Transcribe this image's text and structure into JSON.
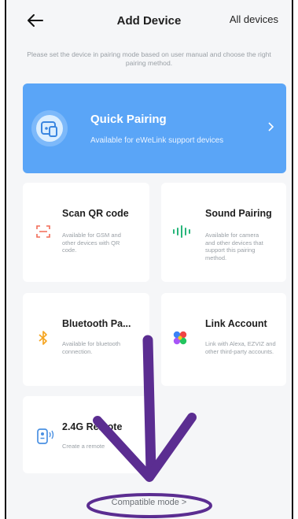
{
  "header": {
    "title": "Add Device",
    "all_devices": "All devices"
  },
  "hint": "Please set the device in pairing mode based on user manual and choose the right pairing method.",
  "quick_pairing": {
    "title": "Quick Pairing",
    "subtitle": "Available for eWeLink support devices"
  },
  "options": {
    "scan_qr": {
      "title": "Scan QR code",
      "desc": "Available for GSM and other devices with QR code."
    },
    "sound": {
      "title": "Sound Pairing",
      "desc": "Available for camera and other devices that support this pairing method."
    },
    "bluetooth": {
      "title": "Bluetooth Pa...",
      "desc": "Available for bluetooth connection."
    },
    "link": {
      "title": "Link Account",
      "desc": "Link with Alexa, EZVIZ and other third-party accounts."
    },
    "remote": {
      "title": "2.4G Remote",
      "desc": "Create a remote"
    }
  },
  "compatible_mode": "Compatible mode >",
  "colors": {
    "accent": "#5aa5f7",
    "annotation": "#5b2d91",
    "qr_icon": "#f26b57",
    "sound_icon": "#27b57a",
    "bluetooth_icon": "#f5a623",
    "remote_icon": "#4a90e2"
  }
}
